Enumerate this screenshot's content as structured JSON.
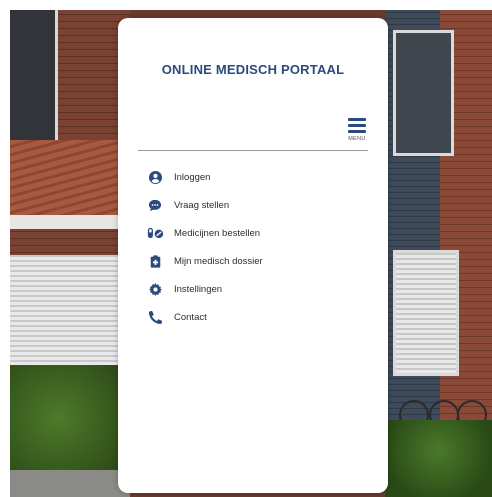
{
  "portal": {
    "title": "ONLINE MEDISCH PORTAAL"
  },
  "menu": {
    "label": "MENU"
  },
  "nav": {
    "items": [
      {
        "label": "Inloggen",
        "icon": "user-circle-icon"
      },
      {
        "label": "Vraag stellen",
        "icon": "chat-bubble-icon"
      },
      {
        "label": "Medicijnen bestellen",
        "icon": "pills-icon"
      },
      {
        "label": "Mijn medisch dossier",
        "icon": "medical-file-icon"
      },
      {
        "label": "Instellingen",
        "icon": "gear-icon"
      },
      {
        "label": "Contact",
        "icon": "phone-icon"
      }
    ]
  },
  "colors": {
    "brand": "#2b4a7d",
    "panel": "#ffffff",
    "text": "#2d2d2d"
  }
}
